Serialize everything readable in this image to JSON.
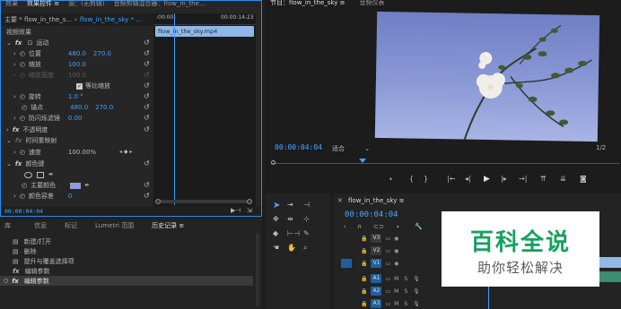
{
  "effect_controls": {
    "tabs": [
      "效果",
      "效果控件 ≡",
      "源：(无剪辑)",
      "音频剪辑混合器：flow_in_the..."
    ],
    "clip_master": "主要 * flow_in_the_s...",
    "clip_seq": "flow_in_the_sky * ...",
    "ruler_start": ":00:00",
    "ruler_end": "00:00:14:23",
    "clip_bar_label": "flow_in_the_sky.mp4",
    "section_video": "视频效果",
    "motion": "运动",
    "position_label": "位置",
    "position_x": "480.0",
    "position_y": "270.0",
    "scale_label": "缩放",
    "scale_value": "100.0",
    "scale_width_label": "缩放宽度",
    "scale_width_value": "100.0",
    "uniform_scale": "等比缩放",
    "rotation_label": "旋转",
    "rotation_value": "1.0 °",
    "anchor_label": "锚点",
    "anchor_x": "480.0",
    "anchor_y": "270.0",
    "flicker_label": "防闪烁滤镜",
    "flicker_value": "0.00",
    "opacity": "不透明度",
    "time_remap": "时间重映射",
    "speed_label": "速度",
    "speed_value": "100.00%",
    "color_key": "颜色键",
    "key_color_label": "主要颜色",
    "color_tolerance_label": "颜色容差",
    "color_tolerance_value": "0",
    "timecode": "00:00:04:04"
  },
  "program_monitor": {
    "tabs": [
      "节目：flow_in_the_sky ≡",
      "音频仪表"
    ],
    "timecode": "00:00:04:04",
    "fit_label": "适合",
    "fraction": "1/2"
  },
  "history": {
    "tabs": [
      "库",
      "信息",
      "标记",
      "Lumetri 范围",
      "历史记录 ≡"
    ],
    "items": [
      "新建/打开",
      "删除",
      "提升与覆盖选择项",
      "编辑参数",
      "编辑参数"
    ]
  },
  "timeline": {
    "seq_name": "flow_in_the_sky ≡",
    "timecode": "00:00:04:04",
    "tracks": [
      {
        "name": "V3",
        "type": "video",
        "active": false
      },
      {
        "name": "V2",
        "type": "video",
        "active": false
      },
      {
        "name": "V1",
        "type": "video",
        "active": true
      },
      {
        "name": "A1",
        "type": "audio",
        "active": true
      },
      {
        "name": "A2",
        "type": "audio",
        "active": true
      },
      {
        "name": "A3",
        "type": "audio",
        "active": true
      }
    ]
  },
  "watermark": {
    "title": "百科全说",
    "subtitle": "助你轻松解决"
  },
  "colors": {
    "accent": "#2d8ceb",
    "timecode": "#4aa8ff",
    "panel_bg": "#232323",
    "track_blue": "#1f5f9e"
  }
}
